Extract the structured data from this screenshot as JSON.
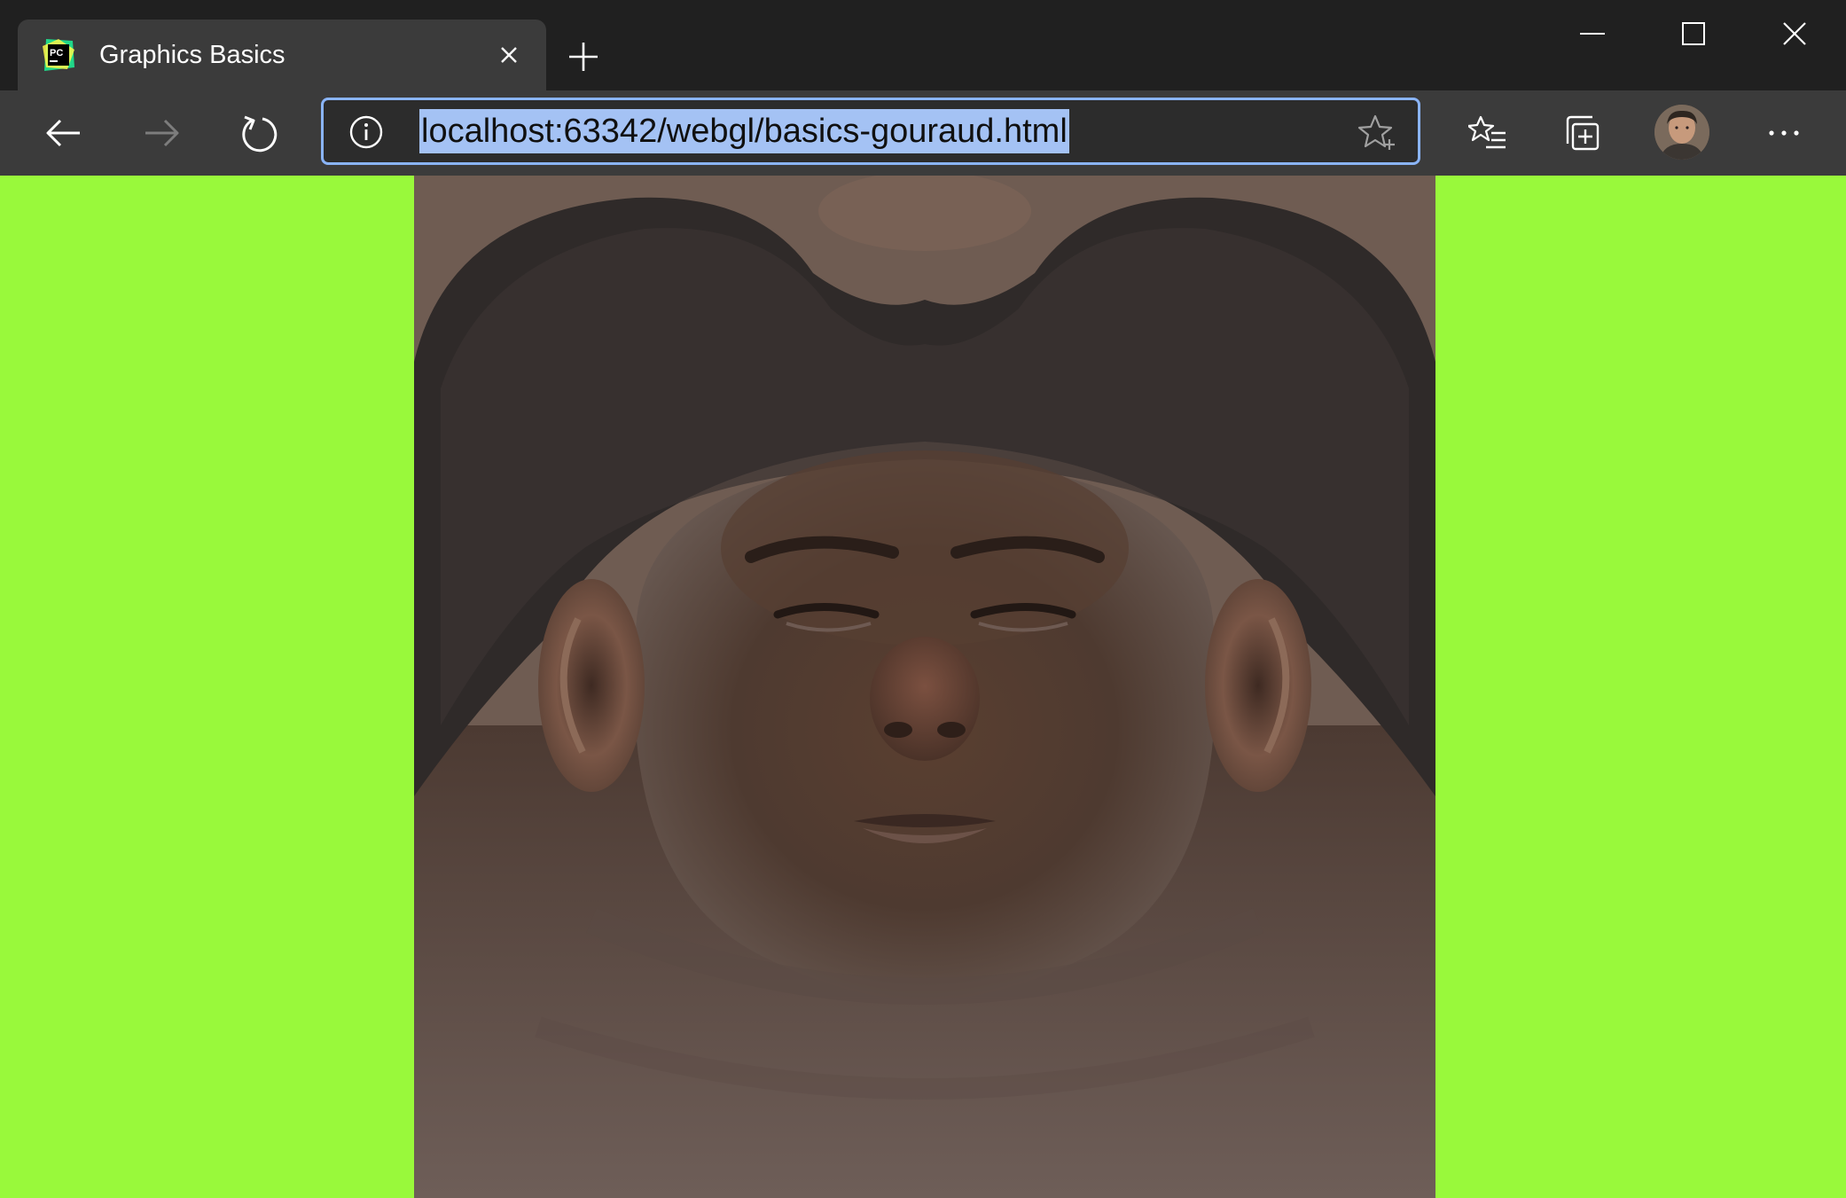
{
  "browser": {
    "tab": {
      "title": "Graphics Basics",
      "favicon": "pycharm-logo-icon",
      "favicon_text": "PC"
    },
    "window_controls": [
      "minimize-icon",
      "maximize-icon",
      "close-icon"
    ],
    "toolbar": {
      "back": "back-arrow-icon",
      "forward": "forward-arrow-icon",
      "reload": "reload-icon",
      "address": "localhost:63342/webgl/basics-gouraud.html",
      "site_info": "info-icon",
      "add_favorite": "star-add-icon",
      "favorites": "favorites-list-icon",
      "collections": "collections-icon",
      "profile": "profile-avatar",
      "more": "more-menu-icon"
    }
  },
  "page": {
    "background_color": "#99f93b",
    "canvas_content": "unwrapped head texture rendered on WebGL canvas"
  },
  "colors": {
    "tab_bar": "#202020",
    "toolbar": "#3b3b3b",
    "address_border": "#8ab4f8",
    "url_selection": "#a4c2f4",
    "page_bg": "#99f93b",
    "skin": "#5e4536",
    "hair": "#2e2a2a"
  }
}
